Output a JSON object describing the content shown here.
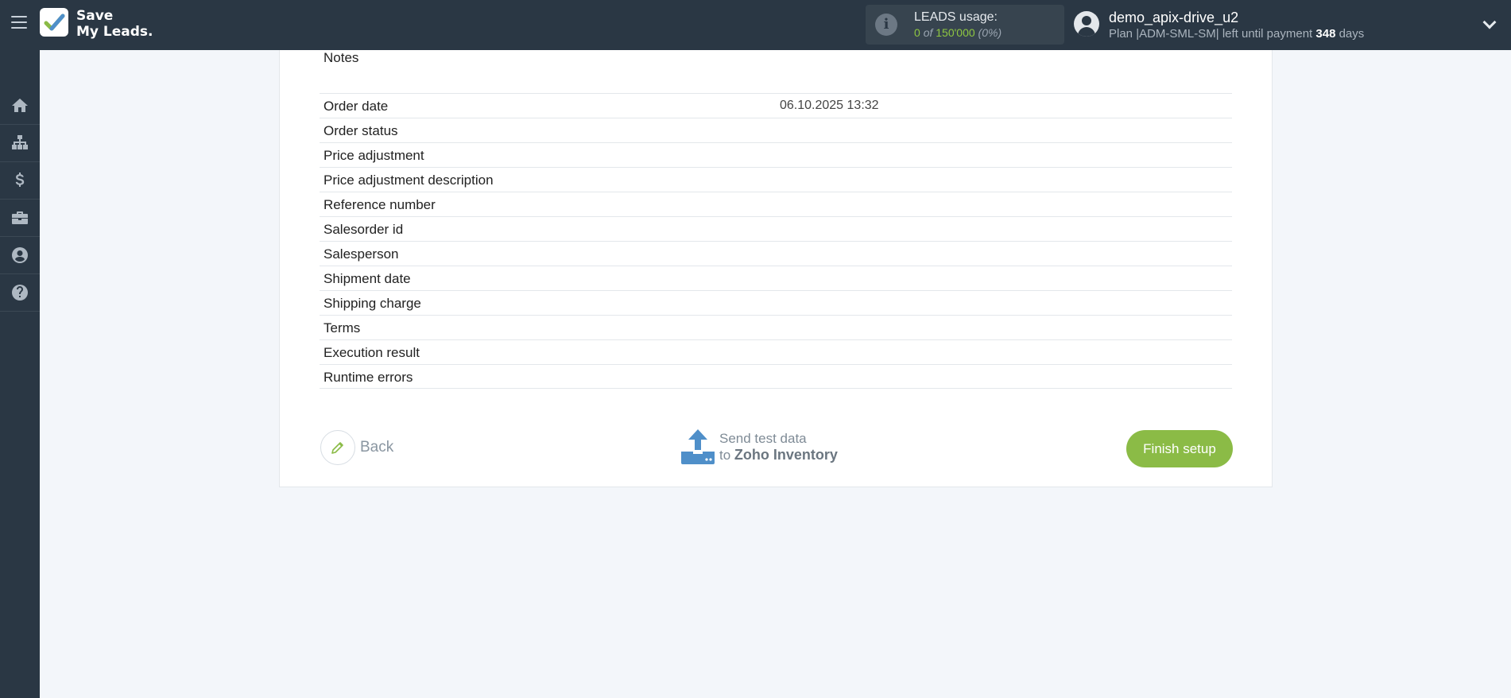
{
  "app": {
    "logo_line1": "Save",
    "logo_line2": "My Leads."
  },
  "usage": {
    "title": "LEADS usage:",
    "used": "0",
    "of": "of",
    "limit": "150'000",
    "percent": "(0%)"
  },
  "user": {
    "name": "demo_apix-drive_u2",
    "plan_prefix": "Plan |ADM-SML-SM| left until payment",
    "days": "348",
    "days_suffix": "days"
  },
  "sidebar": {
    "items": [
      "home-icon",
      "sitemap-icon",
      "dollar-icon",
      "briefcase-icon",
      "account-icon",
      "help-icon"
    ]
  },
  "fields": {
    "notes_label": "Notes",
    "rows": [
      {
        "key": "Order date",
        "value": "06.10.2025 13:32"
      },
      {
        "key": "Order status",
        "value": ""
      },
      {
        "key": "Price adjustment",
        "value": ""
      },
      {
        "key": "Price adjustment description",
        "value": ""
      },
      {
        "key": "Reference number",
        "value": ""
      },
      {
        "key": "Salesorder id",
        "value": ""
      },
      {
        "key": "Salesperson",
        "value": ""
      },
      {
        "key": "Shipment date",
        "value": ""
      },
      {
        "key": "Shipping charge",
        "value": ""
      },
      {
        "key": "Terms",
        "value": ""
      },
      {
        "key": "Execution result",
        "value": ""
      },
      {
        "key": "Runtime errors",
        "value": ""
      }
    ]
  },
  "actions": {
    "back_label": "Back",
    "send_line1": "Send test data",
    "send_to": "to",
    "send_target": "Zoho Inventory",
    "finish_label": "Finish setup"
  },
  "colors": {
    "topbar": "#2a3744",
    "accent_green": "#8bbb46",
    "upload_blue": "#4f8fc9"
  }
}
